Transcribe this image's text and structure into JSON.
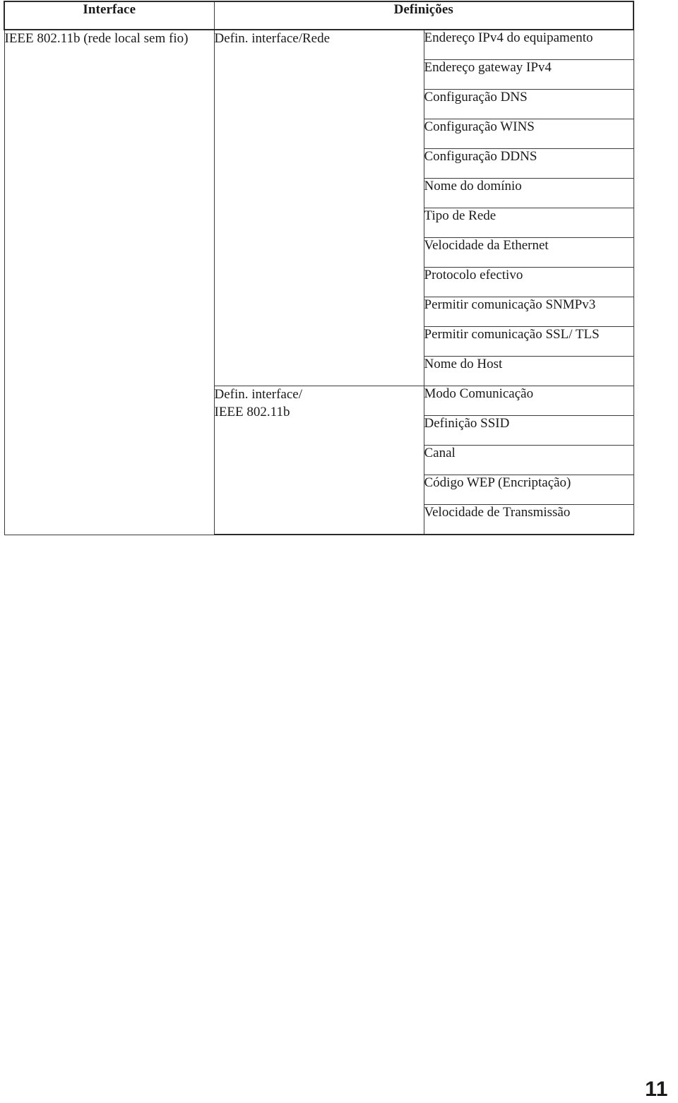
{
  "document": {
    "page_number": "11"
  },
  "table": {
    "headers": {
      "interface": "Interface",
      "definitions": "Definições"
    },
    "interface_label_line1": "IEEE 802.11b (rede local",
    "interface_label_line2": "sem fio)",
    "groups": [
      {
        "label_line1": "Defin. interface/Rede",
        "label_line2": "",
        "rowspan": 11,
        "items": [
          "Endereço IPv4 do equipamento",
          "Endereço gateway IPv4",
          "Configuração DNS",
          "Configuração WINS",
          "Configuração DDNS",
          "Nome do domínio",
          "Tipo de Rede",
          "Velocidade da Ethernet",
          "Protocolo efectivo",
          "Permitir comunicação SNMPv3",
          "Permitir comunicação SSL/ TLS",
          "Nome do Host"
        ]
      },
      {
        "label_line1": "Defin. interface/",
        "label_line2": "IEEE 802.11b",
        "rowspan": 5,
        "items": [
          "Modo Comunicação",
          "Definição SSID",
          "Canal",
          "Código WEP (Encriptação)",
          "Velocidade de Transmissão"
        ]
      }
    ]
  }
}
